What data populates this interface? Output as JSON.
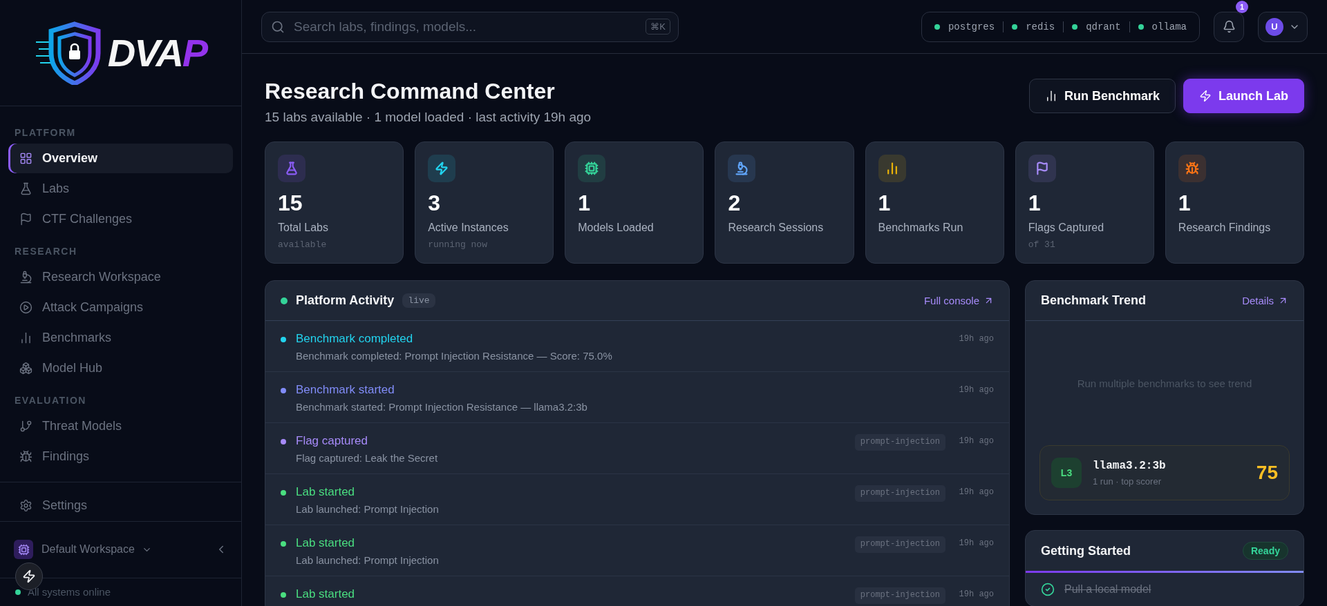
{
  "sidebar": {
    "logo": {
      "main": "DVA",
      "accent": "P"
    },
    "sections": [
      {
        "heading": "PLATFORM",
        "items": [
          {
            "label": "Overview",
            "selected": true
          },
          {
            "label": "Labs",
            "selected": false
          },
          {
            "label": "CTF Challenges",
            "selected": false
          }
        ]
      },
      {
        "heading": "RESEARCH",
        "items": [
          {
            "label": "Research Workspace",
            "selected": false
          },
          {
            "label": "Attack Campaigns",
            "selected": false
          },
          {
            "label": "Benchmarks",
            "selected": false
          },
          {
            "label": "Model Hub",
            "selected": false
          }
        ]
      },
      {
        "heading": "EVALUATION",
        "items": [
          {
            "label": "Threat Models",
            "selected": false
          },
          {
            "label": "Findings",
            "selected": false
          }
        ]
      }
    ],
    "settings": {
      "label": "Settings",
      "selected": false
    },
    "workspace": {
      "name": "Default Workspace"
    },
    "status": {
      "text": "All systems online",
      "online": true
    }
  },
  "topbar": {
    "search": {
      "placeholder": "Search labs, findings, models...",
      "shortcut": "⌘K"
    },
    "services": [
      {
        "name": "postgres",
        "online": true
      },
      {
        "name": "redis",
        "online": true
      },
      {
        "name": "qdrant",
        "online": true
      },
      {
        "name": "ollama",
        "online": true
      }
    ],
    "notifications": {
      "count": "1"
    },
    "avatar": {
      "initial": "U"
    }
  },
  "header": {
    "title": "Research Command Center",
    "subtitle": "15 labs available · 1 model loaded · last activity 19h ago",
    "buttons": [
      {
        "label": "Run Benchmark",
        "kind": "secondary"
      },
      {
        "label": "Launch Lab",
        "kind": "primary"
      }
    ]
  },
  "stats": [
    {
      "value": "15",
      "label": "Total Labs",
      "sub": "available",
      "color": "#8b5cf6"
    },
    {
      "value": "3",
      "label": "Active Instances",
      "sub": "running now",
      "color": "#22d3ee"
    },
    {
      "value": "1",
      "label": "Models Loaded",
      "color": "#34d399"
    },
    {
      "value": "2",
      "label": "Research Sessions",
      "color": "#60a5fa"
    },
    {
      "value": "1",
      "label": "Benchmarks Run",
      "color": "#eab308"
    },
    {
      "value": "1",
      "label": "Flags Captured",
      "sub": "of 31",
      "color": "#a78bfa"
    },
    {
      "value": "1",
      "label": "Research Findings",
      "color": "#f97316"
    }
  ],
  "activity": {
    "title": "Platform Activity",
    "badge": "live",
    "live": true,
    "link": "Full console",
    "items": [
      {
        "title": "Benchmark completed",
        "detail": "Benchmark completed: Prompt Injection Resistance — Score: 75.0%",
        "time": "19h ago",
        "color": "#22d3ee"
      },
      {
        "title": "Benchmark started",
        "detail": "Benchmark started: Prompt Injection Resistance — llama3.2:3b",
        "time": "19h ago",
        "color": "#818cf8"
      },
      {
        "title": "Flag captured",
        "detail": "Flag captured: Leak the Secret",
        "tag": "prompt-injection",
        "time": "19h ago",
        "color": "#a78bfa"
      },
      {
        "title": "Lab started",
        "detail": "Lab launched: Prompt Injection",
        "tag": "prompt-injection",
        "time": "19h ago",
        "color": "#4ade80"
      },
      {
        "title": "Lab started",
        "detail": "Lab launched: Prompt Injection",
        "tag": "prompt-injection",
        "time": "19h ago",
        "color": "#4ade80"
      },
      {
        "title": "Lab started",
        "tag": "prompt-injection",
        "time": "19h ago",
        "color": "#4ade80"
      }
    ]
  },
  "trend": {
    "title": "Benchmark Trend",
    "link": "Details",
    "empty": "Run multiple benchmarks to see trend",
    "top": {
      "badge": "L3",
      "model": "llama3.2:3b",
      "meta": "1 run · top scorer",
      "score": "75"
    }
  },
  "getting_started": {
    "title": "Getting Started",
    "badge": "Ready",
    "level": 1,
    "steps": [
      {
        "label": "Pull a local model",
        "checked": true
      }
    ]
  }
}
